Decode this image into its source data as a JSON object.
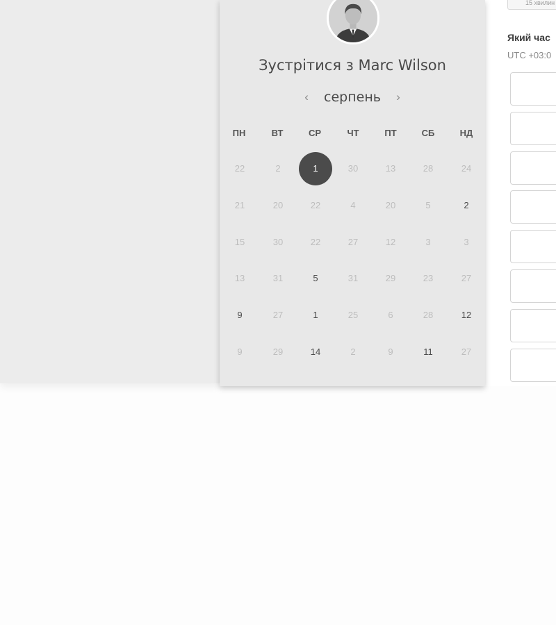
{
  "calendar": {
    "title": "Зустрітися з Marc Wilson",
    "month": "серпень",
    "prev_icon": "chevron-left-icon",
    "next_icon": "chevron-right-icon",
    "weekdays": [
      "ПН",
      "ВТ",
      "СР",
      "ЧТ",
      "ПТ",
      "СБ",
      "НД"
    ],
    "weeks": [
      [
        {
          "day": "22",
          "state": "disabled"
        },
        {
          "day": "2",
          "state": "disabled"
        },
        {
          "day": "1",
          "state": "selected"
        },
        {
          "day": "30",
          "state": "disabled"
        },
        {
          "day": "13",
          "state": "disabled"
        },
        {
          "day": "28",
          "state": "disabled"
        },
        {
          "day": "24",
          "state": "disabled"
        }
      ],
      [
        {
          "day": "21",
          "state": "disabled"
        },
        {
          "day": "20",
          "state": "disabled"
        },
        {
          "day": "22",
          "state": "disabled"
        },
        {
          "day": "4",
          "state": "disabled"
        },
        {
          "day": "20",
          "state": "disabled"
        },
        {
          "day": "5",
          "state": "disabled"
        },
        {
          "day": "2",
          "state": "available"
        }
      ],
      [
        {
          "day": "15",
          "state": "disabled"
        },
        {
          "day": "30",
          "state": "disabled"
        },
        {
          "day": "22",
          "state": "disabled"
        },
        {
          "day": "27",
          "state": "disabled"
        },
        {
          "day": "12",
          "state": "disabled"
        },
        {
          "day": "3",
          "state": "disabled"
        },
        {
          "day": "3",
          "state": "disabled"
        }
      ],
      [
        {
          "day": "13",
          "state": "disabled"
        },
        {
          "day": "31",
          "state": "disabled"
        },
        {
          "day": "5",
          "state": "available"
        },
        {
          "day": "31",
          "state": "disabled"
        },
        {
          "day": "29",
          "state": "disabled"
        },
        {
          "day": "23",
          "state": "disabled"
        },
        {
          "day": "27",
          "state": "disabled"
        }
      ],
      [
        {
          "day": "9",
          "state": "available"
        },
        {
          "day": "27",
          "state": "disabled"
        },
        {
          "day": "1",
          "state": "available"
        },
        {
          "day": "25",
          "state": "disabled"
        },
        {
          "day": "6",
          "state": "disabled"
        },
        {
          "day": "28",
          "state": "disabled"
        },
        {
          "day": "12",
          "state": "available"
        }
      ],
      [
        {
          "day": "9",
          "state": "disabled"
        },
        {
          "day": "29",
          "state": "disabled"
        },
        {
          "day": "14",
          "state": "available"
        },
        {
          "day": "2",
          "state": "disabled"
        },
        {
          "day": "9",
          "state": "disabled"
        },
        {
          "day": "11",
          "state": "available"
        },
        {
          "day": "27",
          "state": "disabled"
        }
      ]
    ]
  },
  "times": {
    "duration_button": "15 хвилин",
    "question": "Який час",
    "timezone": "UTC +03:0",
    "slot_count": 8
  },
  "colors": {
    "selected_day": "#4b4b4b",
    "available_day": "#4a4a4a",
    "disabled_day": "#bdbdbd",
    "card_background": "#e8e8e8"
  }
}
